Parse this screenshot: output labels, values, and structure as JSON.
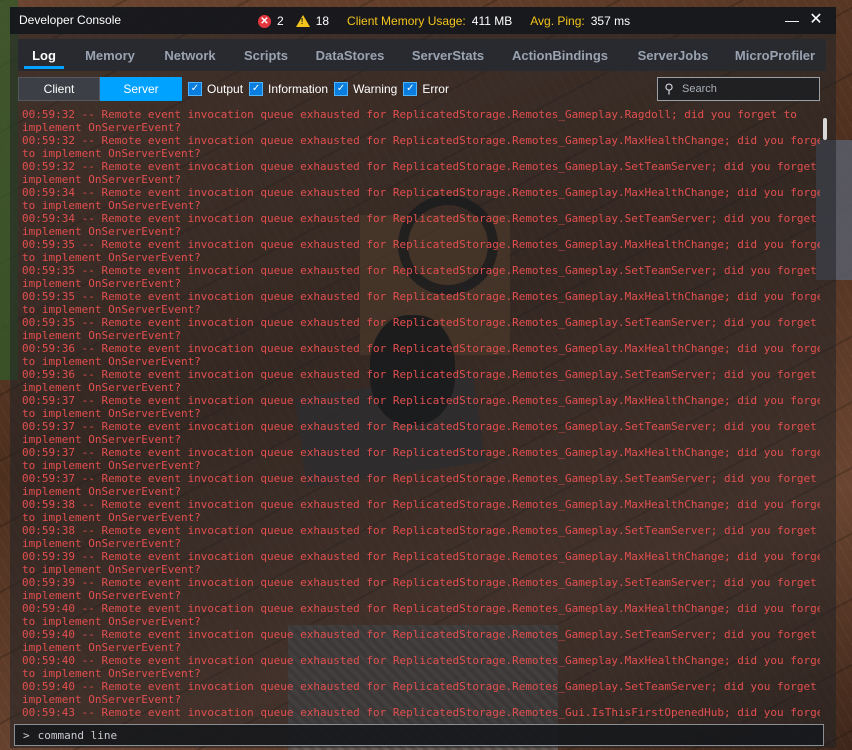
{
  "window": {
    "title": "Developer Console",
    "errors_count": "2",
    "warnings_count": "18",
    "memory_label": "Client Memory Usage:",
    "memory_value": "411 MB",
    "ping_label": "Avg. Ping:",
    "ping_value": "357 ms",
    "minimize_glyph": "—",
    "close_glyph": "✕"
  },
  "tabs": [
    "Log",
    "Memory",
    "Network",
    "Scripts",
    "DataStores",
    "ServerStats",
    "ActionBindings",
    "ServerJobs",
    "MicroProfiler"
  ],
  "active_tab": "Log",
  "filter": {
    "client_label": "Client",
    "server_label": "Server",
    "active": "Server",
    "checkboxes": [
      {
        "label": "Output",
        "checked": true
      },
      {
        "label": "Information",
        "checked": true
      },
      {
        "label": "Warning",
        "checked": true
      },
      {
        "label": "Error",
        "checked": true
      }
    ]
  },
  "search": {
    "placeholder": "Search"
  },
  "log_entries": [
    "00:59:32 -- Remote event invocation queue exhausted for ReplicatedStorage.Remotes_Gameplay.Ragdoll; did you forget to",
    "implement OnServerEvent?",
    "00:59:32 -- Remote event invocation queue exhausted for ReplicatedStorage.Remotes_Gameplay.MaxHealthChange; did you forge",
    "to implement OnServerEvent?",
    "00:59:32 -- Remote event invocation queue exhausted for ReplicatedStorage.Remotes_Gameplay.SetTeamServer; did you forget",
    "implement OnServerEvent?",
    "00:59:34 -- Remote event invocation queue exhausted for ReplicatedStorage.Remotes_Gameplay.MaxHealthChange; did you forge",
    "to implement OnServerEvent?",
    "00:59:34 -- Remote event invocation queue exhausted for ReplicatedStorage.Remotes_Gameplay.SetTeamServer; did you forget",
    "implement OnServerEvent?",
    "00:59:35 -- Remote event invocation queue exhausted for ReplicatedStorage.Remotes_Gameplay.MaxHealthChange; did you forge",
    "to implement OnServerEvent?",
    "00:59:35 -- Remote event invocation queue exhausted for ReplicatedStorage.Remotes_Gameplay.SetTeamServer; did you forget",
    "implement OnServerEvent?",
    "00:59:35 -- Remote event invocation queue exhausted for ReplicatedStorage.Remotes_Gameplay.MaxHealthChange; did you forge",
    "to implement OnServerEvent?",
    "00:59:35 -- Remote event invocation queue exhausted for ReplicatedStorage.Remotes_Gameplay.SetTeamServer; did you forget",
    "implement OnServerEvent?",
    "00:59:36 -- Remote event invocation queue exhausted for ReplicatedStorage.Remotes_Gameplay.MaxHealthChange; did you forge",
    "to implement OnServerEvent?",
    "00:59:36 -- Remote event invocation queue exhausted for ReplicatedStorage.Remotes_Gameplay.SetTeamServer; did you forget",
    "implement OnServerEvent?",
    "00:59:37 -- Remote event invocation queue exhausted for ReplicatedStorage.Remotes_Gameplay.MaxHealthChange; did you forge",
    "to implement OnServerEvent?",
    "00:59:37 -- Remote event invocation queue exhausted for ReplicatedStorage.Remotes_Gameplay.SetTeamServer; did you forget",
    "implement OnServerEvent?",
    "00:59:37 -- Remote event invocation queue exhausted for ReplicatedStorage.Remotes_Gameplay.MaxHealthChange; did you forge",
    "to implement OnServerEvent?",
    "00:59:37 -- Remote event invocation queue exhausted for ReplicatedStorage.Remotes_Gameplay.SetTeamServer; did you forget",
    "implement OnServerEvent?",
    "00:59:38 -- Remote event invocation queue exhausted for ReplicatedStorage.Remotes_Gameplay.MaxHealthChange; did you forge",
    "to implement OnServerEvent?",
    "00:59:38 -- Remote event invocation queue exhausted for ReplicatedStorage.Remotes_Gameplay.SetTeamServer; did you forget",
    "implement OnServerEvent?",
    "00:59:39 -- Remote event invocation queue exhausted for ReplicatedStorage.Remotes_Gameplay.MaxHealthChange; did you forge",
    "to implement OnServerEvent?",
    "00:59:39 -- Remote event invocation queue exhausted for ReplicatedStorage.Remotes_Gameplay.SetTeamServer; did you forget",
    "implement OnServerEvent?",
    "00:59:40 -- Remote event invocation queue exhausted for ReplicatedStorage.Remotes_Gameplay.MaxHealthChange; did you forge",
    "to implement OnServerEvent?",
    "00:59:40 -- Remote event invocation queue exhausted for ReplicatedStorage.Remotes_Gameplay.SetTeamServer; did you forget",
    "implement OnServerEvent?",
    "00:59:40 -- Remote event invocation queue exhausted for ReplicatedStorage.Remotes_Gameplay.MaxHealthChange; did you forge",
    "to implement OnServerEvent?",
    "00:59:40 -- Remote event invocation queue exhausted for ReplicatedStorage.Remotes_Gameplay.SetTeamServer; did you forget",
    "implement OnServerEvent?",
    "00:59:43 -- Remote event invocation queue exhausted for ReplicatedStorage.Remotes_Gui.IsThisFirstOpenedHub; did you forge"
  ],
  "command_line": {
    "prompt": ">",
    "placeholder": "command line"
  },
  "colors": {
    "accent": "#00a2ff",
    "error_text": "#e14f4f",
    "stat_label": "#f3c41c",
    "error_badge": "#e2363f",
    "warning_badge": "#f3c41c"
  }
}
